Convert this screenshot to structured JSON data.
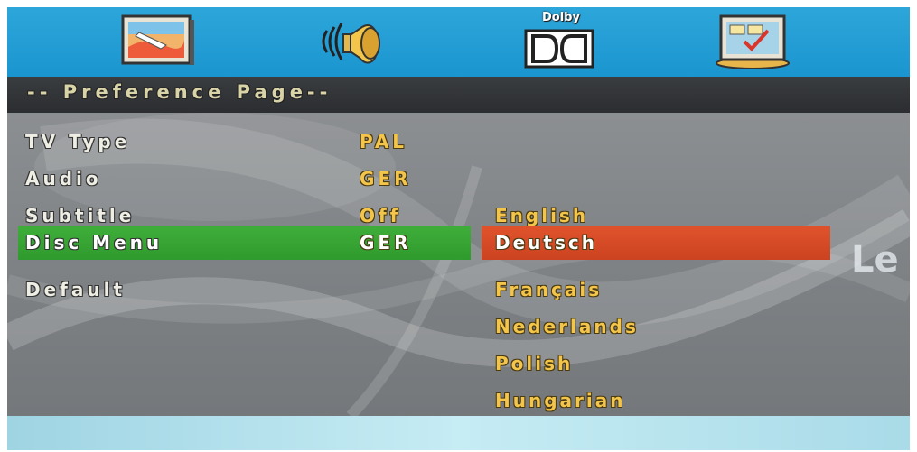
{
  "header": {
    "title": "-- Preference Page--"
  },
  "tabs": [
    {
      "icon": "general-setup-icon"
    },
    {
      "icon": "audio-setup-icon"
    },
    {
      "icon": "dolby-setup-icon",
      "label": "Dolby"
    },
    {
      "icon": "preference-setup-icon"
    }
  ],
  "menu": [
    {
      "label": "TV Type",
      "value": "PAL"
    },
    {
      "label": "Audio",
      "value": "GER"
    },
    {
      "label": "Subtitle",
      "value": "Off"
    },
    {
      "label": "Disc Menu",
      "value": "GER"
    },
    {
      "label": "Default",
      "value": ""
    }
  ],
  "options": [
    "English",
    "Deutsch",
    "Français",
    "Nederlands",
    "Polish",
    "Hungarian"
  ],
  "selected_menu_index": 3,
  "selected_option_index": 1,
  "side_text": "Le",
  "colors": {
    "tab_bar": "#1b95cf",
    "selected_row": "#35a431",
    "selected_option": "#d64a26",
    "value_text": "#f3c54a"
  }
}
